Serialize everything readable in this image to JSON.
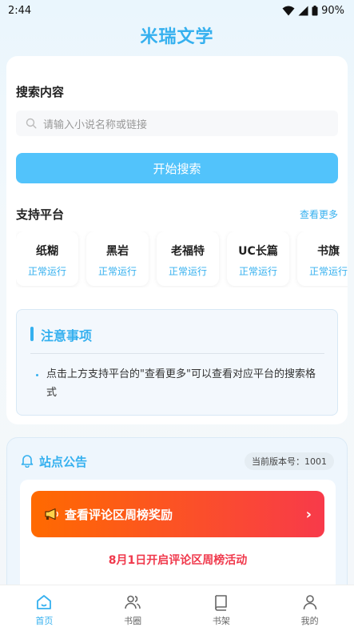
{
  "status_bar": {
    "time": "2:44",
    "battery": "90%"
  },
  "app": {
    "title": "米瑞文学"
  },
  "search": {
    "section_label": "搜索内容",
    "placeholder": "请输入小说名称或链接",
    "button_label": "开始搜索"
  },
  "platforms": {
    "section_label": "支持平台",
    "see_more": "查看更多",
    "items": [
      {
        "name": "纸糊",
        "status": "正常运行"
      },
      {
        "name": "黑岩",
        "status": "正常运行"
      },
      {
        "name": "老福特",
        "status": "正常运行"
      },
      {
        "name": "UC长篇",
        "status": "正常运行"
      },
      {
        "name": "书旗",
        "status": "正常运行"
      }
    ]
  },
  "notice": {
    "title": "注意事项",
    "text": "点击上方支持平台的\"查看更多\"可以查看对应平台的搜索格式"
  },
  "announcement": {
    "title": "站点公告",
    "version": "当前版本号：1001",
    "weekly_button": "查看评论区周榜奖励",
    "activity": "8月1日开启评论区周榜活动"
  },
  "bottom_nav": {
    "items": [
      {
        "label": "首页",
        "icon": "home-icon",
        "active": true
      },
      {
        "label": "书圈",
        "icon": "users-icon",
        "active": false
      },
      {
        "label": "书架",
        "icon": "book-icon",
        "active": false
      },
      {
        "label": "我的",
        "icon": "person-icon",
        "active": false
      }
    ]
  },
  "colors": {
    "accent": "#35b0ef",
    "button": "#52c3fb",
    "alert": "#f0394c"
  }
}
